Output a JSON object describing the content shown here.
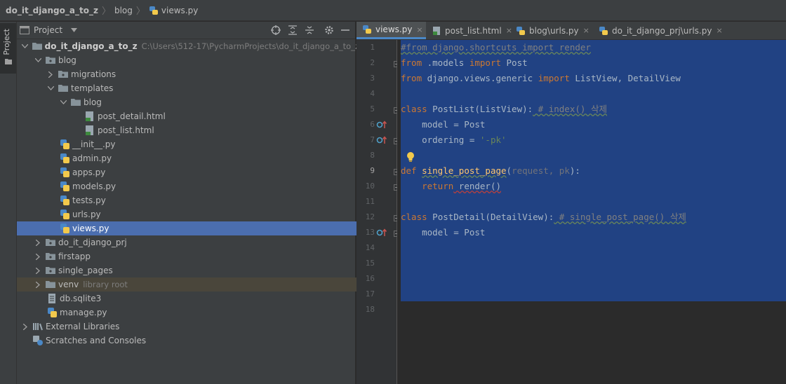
{
  "breadcrumb": {
    "project": "do_it_django_a_to_z",
    "folder": "blog",
    "file": "views.py"
  },
  "tool_stripe": {
    "project_label": "Project"
  },
  "project_panel": {
    "title": "Project",
    "rows": [
      {
        "label": "do_it_django_a_to_z",
        "hint": "C:\\Users\\512-17\\PycharmProjects\\do_it_django_a_to_z"
      },
      {
        "label": "blog"
      },
      {
        "label": "migrations"
      },
      {
        "label": "templates"
      },
      {
        "label": "blog"
      },
      {
        "label": "post_detail.html"
      },
      {
        "label": "post_list.html"
      },
      {
        "label": "__init__.py"
      },
      {
        "label": "admin.py"
      },
      {
        "label": "apps.py"
      },
      {
        "label": "models.py"
      },
      {
        "label": "tests.py"
      },
      {
        "label": "urls.py"
      },
      {
        "label": "views.py"
      },
      {
        "label": "do_it_django_prj"
      },
      {
        "label": "firstapp"
      },
      {
        "label": "single_pages"
      },
      {
        "label": "venv",
        "hint": "library root"
      },
      {
        "label": "db.sqlite3"
      },
      {
        "label": "manage.py"
      },
      {
        "label": "External Libraries"
      },
      {
        "label": "Scratches and Consoles"
      }
    ]
  },
  "tabs": [
    {
      "label": "views.py",
      "close": "×"
    },
    {
      "label": "post_list.html",
      "close": "×"
    },
    {
      "label": "blog\\urls.py",
      "close": "×"
    },
    {
      "label": "do_it_django_prj\\urls.py",
      "close": "×"
    }
  ],
  "editor": {
    "line_numbers": [
      "1",
      "2",
      "3",
      "4",
      "5",
      "6",
      "7",
      "8",
      "9",
      "10",
      "11",
      "12",
      "13",
      "14",
      "15",
      "16",
      "17",
      "18"
    ],
    "code": {
      "l1": "#from django.shortcuts import render",
      "l2_kw": "from",
      "l2_mod": " .models ",
      "l2_kw2": "import",
      "l2_name": " Post",
      "l3_kw": "from",
      "l3_mod": " django.views.generic ",
      "l3_kw2": "import",
      "l3_names": " ListView, DetailView",
      "l5_kw": "class",
      "l5_name": " PostList(ListView):",
      "l5_comment": " # index() 삭제",
      "l6": "    model = Post",
      "l7_a": "    ordering = ",
      "l7_str": "'-pk'",
      "l9_kw": "def",
      "l9_fn": "single_post_page",
      "l9_open": "(",
      "l9_params": "request, pk",
      "l9_close": "):",
      "l10_kw": "    return",
      "l10_call": " render()",
      "l12_kw": "class",
      "l12_name": " PostDetail(DetailView):",
      "l12_comment": " # single_post_page() 삭제",
      "l13": "    model = Post"
    }
  },
  "colors": {
    "selection": "#214283",
    "keyword": "#cc7832",
    "comment": "#808080",
    "string": "#6a8759",
    "function": "#ffc66d",
    "tree_selected": "#4b6eaf"
  }
}
